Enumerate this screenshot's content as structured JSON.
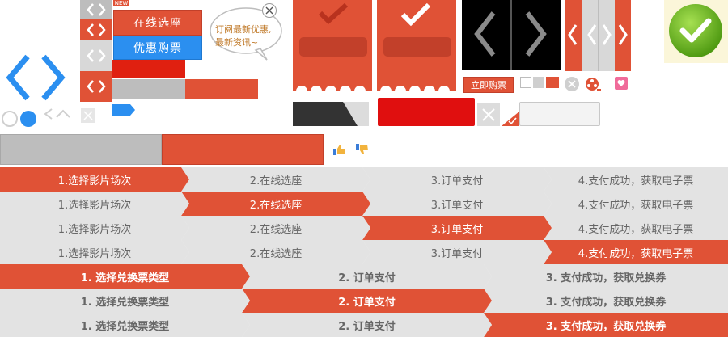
{
  "colors": {
    "accent": "#e05236",
    "accent_dark": "#c2402a",
    "blue": "#2b8ff0",
    "gray": "#dcdcdc",
    "gray_text": "#666666",
    "black": "#111111",
    "green": "#6dbb1e"
  },
  "badge": {
    "new_label": "NEW"
  },
  "buttons": {
    "seat_online": "在线选座",
    "discount_buy": "优惠购票",
    "buy_now": "立即购票"
  },
  "bubble": {
    "line1": "订阅最新优惠,",
    "line2": "最新资讯~"
  },
  "icons": {
    "close": "close-icon",
    "chevron_left": "chevron-left-icon",
    "chevron_right": "chevron-right-icon",
    "checkmark": "checkmark-icon",
    "thumbs_up": "thumbs-up-icon",
    "thumbs_down": "thumbs-down-icon",
    "film_reel": "film-reel-icon",
    "heart": "heart-icon"
  },
  "steps_ticket": {
    "labels": [
      "1.选择影片场次",
      "2.在线选座",
      "3.订单支付",
      "4.支付成功，获取电子票"
    ]
  },
  "steps_exchange": {
    "labels": [
      "1. 选择兑换票类型",
      "2. 订单支付",
      "3. 支付成功，获取兑换券"
    ]
  }
}
